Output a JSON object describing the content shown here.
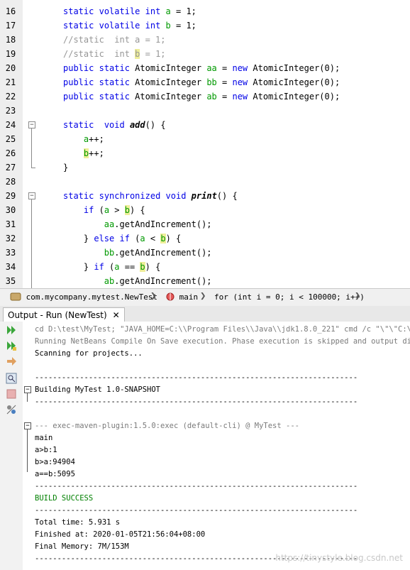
{
  "editor": {
    "lines": [
      {
        "n": "16",
        "html": "<span class='kw'>static</span> <span class='kw'>volatile</span> <span class='kw'>int</span> <span class='fld'>a</span> = 1;"
      },
      {
        "n": "17",
        "html": "<span class='kw'>static</span> <span class='kw'>volatile</span> <span class='kw'>int</span> <span class='fld'>b</span> = 1;"
      },
      {
        "n": "18",
        "html": "<span class='cm'>//static  int a = 1;</span>"
      },
      {
        "n": "19",
        "html": "<span class='cm'>//static  int <span class='hl'>b</span> = 1;</span>"
      },
      {
        "n": "20",
        "html": "<span class='kw'>public</span> <span class='kw'>static</span> AtomicInteger <span class='fld'>aa</span> = <span class='kw'>new</span> AtomicInteger(0);"
      },
      {
        "n": "21",
        "html": "<span class='kw'>public</span> <span class='kw'>static</span> AtomicInteger <span class='fld'>bb</span> = <span class='kw'>new</span> AtomicInteger(0);"
      },
      {
        "n": "22",
        "html": "<span class='kw'>public</span> <span class='kw'>static</span> AtomicInteger <span class='fld'>ab</span> = <span class='kw'>new</span> AtomicInteger(0);"
      },
      {
        "n": "23",
        "html": ""
      },
      {
        "n": "24",
        "html": "<span class='kw'>static</span>  <span class='kw'>void</span> <span class='mth'>add</span>() {"
      },
      {
        "n": "25",
        "html": "    <span class='fld'>a</span>++;"
      },
      {
        "n": "26",
        "html": "    <span class='fld hl'>b</span>++;"
      },
      {
        "n": "27",
        "html": "}"
      },
      {
        "n": "28",
        "html": ""
      },
      {
        "n": "29",
        "html": "<span class='kw'>static</span> <span class='kw'>synchronized</span> <span class='kw'>void</span> <span class='mth'>print</span>() {"
      },
      {
        "n": "30",
        "html": "    <span class='kw'>if</span> (<span class='fld'>a</span> &gt; <span class='fld hl'>b</span>) {"
      },
      {
        "n": "31",
        "html": "        <span class='fld'>aa</span>.getAndIncrement();"
      },
      {
        "n": "32",
        "html": "    } <span class='kw'>else</span> <span class='kw'>if</span> (<span class='fld'>a</span> &lt; <span class='fld hl'>b</span>) {"
      },
      {
        "n": "33",
        "html": "        <span class='fld'>bb</span>.getAndIncrement();"
      },
      {
        "n": "34",
        "html": "    } <span class='kw'>if</span> (<span class='fld'>a</span> == <span class='fld hl'>b</span>) {"
      },
      {
        "n": "35",
        "html": "        <span class='fld'>ab</span>.getAndIncrement();"
      }
    ]
  },
  "breadcrumb": {
    "class_label": "com.mycompany.mytest.NewTest",
    "method_label": "main",
    "loop_label": "for (int i = 0; i < 100000; i++)"
  },
  "output_tab": {
    "label": "Output - Run (NewTest)",
    "close": "✕"
  },
  "output": {
    "lines": [
      {
        "text": "cd D:\\test\\MyTest; \"JAVA_HOME=C:\\\\Program Files\\\\Java\\\\jdk1.8.0_221\" cmd /c \"\\\"\\\"C:\\\\Pro",
        "cls": "grey"
      },
      {
        "text": "Running NetBeans Compile On Save execution. Phase execution is skipped and output directo",
        "cls": "grey"
      },
      {
        "text": "Scanning for projects...",
        "cls": ""
      },
      {
        "text": "",
        "cls": ""
      },
      {
        "text": "------------------------------------------------------------------------",
        "cls": ""
      },
      {
        "text": "Building MyTest 1.0-SNAPSHOT",
        "cls": ""
      },
      {
        "text": "------------------------------------------------------------------------",
        "cls": ""
      },
      {
        "text": "",
        "cls": ""
      },
      {
        "text": "--- exec-maven-plugin:1.5.0:exec (default-cli) @ MyTest ---",
        "cls": "grey"
      },
      {
        "text": "main",
        "cls": ""
      },
      {
        "text": "a>b:1",
        "cls": ""
      },
      {
        "text": "b>a:94904",
        "cls": ""
      },
      {
        "text": "a==b:5095",
        "cls": ""
      },
      {
        "text": "------------------------------------------------------------------------",
        "cls": ""
      },
      {
        "text": "BUILD SUCCESS",
        "cls": "green"
      },
      {
        "text": "------------------------------------------------------------------------",
        "cls": ""
      },
      {
        "text": "Total time: 5.931 s",
        "cls": ""
      },
      {
        "text": "Finished at: 2020-01-05T21:56:04+08:00",
        "cls": ""
      },
      {
        "text": "Final Memory: 7M/153M",
        "cls": ""
      },
      {
        "text": "------------------------------------------------------------------------",
        "cls": ""
      }
    ]
  },
  "watermark": "https://tinystyle.blog.csdn.net",
  "colors": {
    "keyword": "#0000e6",
    "field": "#009900",
    "comment": "#969696",
    "highlight": "#eeee99",
    "success": "#008000"
  },
  "icons": [
    "rerun-icon",
    "rerun-with-args-icon",
    "stop-arrow-icon",
    "inspect-icon",
    "stop-icon",
    "settings-icon"
  ]
}
